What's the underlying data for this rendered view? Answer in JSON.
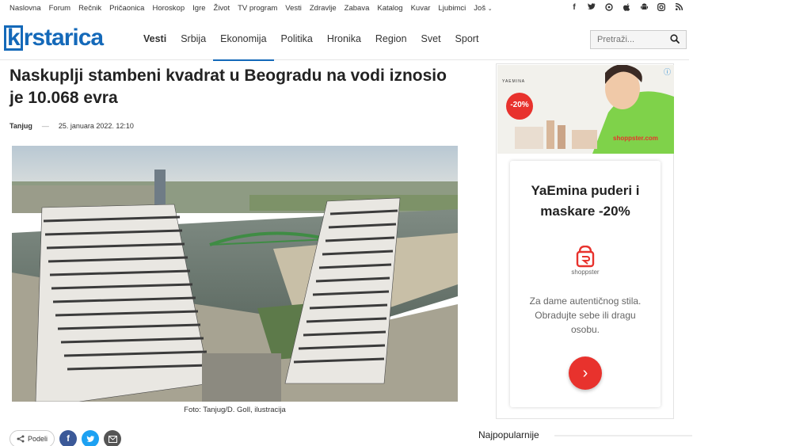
{
  "topnav": [
    "Naslovna",
    "Forum",
    "Rečnik",
    "Pričaonica",
    "Horoskop",
    "Igre",
    "Život",
    "TV program",
    "Vesti",
    "Zdravlje",
    "Zabava",
    "Katalog",
    "Kuvar",
    "Ljubimci",
    "Još"
  ],
  "social": [
    {
      "name": "facebook",
      "glyph": "f"
    },
    {
      "name": "twitter",
      "glyph": "t"
    },
    {
      "name": "viber",
      "glyph": "v"
    },
    {
      "name": "apple",
      "glyph": "a"
    },
    {
      "name": "android",
      "glyph": "A"
    },
    {
      "name": "instagram",
      "glyph": "i"
    },
    {
      "name": "rss",
      "glyph": "r"
    }
  ],
  "logo": {
    "k": "k",
    "rest": "rstarica"
  },
  "mainnav": [
    {
      "label": "Vesti",
      "bold": true,
      "active": false
    },
    {
      "label": "Srbija",
      "bold": false,
      "active": false
    },
    {
      "label": "Ekonomija",
      "bold": false,
      "active": true
    },
    {
      "label": "Politika",
      "bold": false,
      "active": false
    },
    {
      "label": "Hronika",
      "bold": false,
      "active": false
    },
    {
      "label": "Region",
      "bold": false,
      "active": false
    },
    {
      "label": "Svet",
      "bold": false,
      "active": false
    },
    {
      "label": "Sport",
      "bold": false,
      "active": false
    }
  ],
  "search": {
    "placeholder": "Pretraži..."
  },
  "article": {
    "title": "Naskuplji stambeni kvadrat u Beogradu na vodi iznosio je 10.068 evra",
    "author": "Tanjug",
    "date": "25. januara 2022. 12:10",
    "caption": "Foto: Tanjug/D. Goll, ilustracija"
  },
  "share": {
    "label": "Podeli"
  },
  "ad": {
    "banner_badge": "-20%",
    "banner_brand": "YAEMINA",
    "banner_site": "shoppster.com",
    "title": "YaEmina puderi i maskare -20%",
    "brand": "shoppster",
    "body": "Za dame autentičnog stila. Obradujte sebe ili dragu osobu.",
    "cta": "›",
    "info": "ⓘ"
  },
  "sidebar": {
    "popular_heading": "Najpopularnije"
  },
  "colors": {
    "brand": "#1469b9",
    "ad_red": "#e8322d",
    "facebook": "#3b5998",
    "twitter": "#1da1f2",
    "mail": "#555555"
  }
}
